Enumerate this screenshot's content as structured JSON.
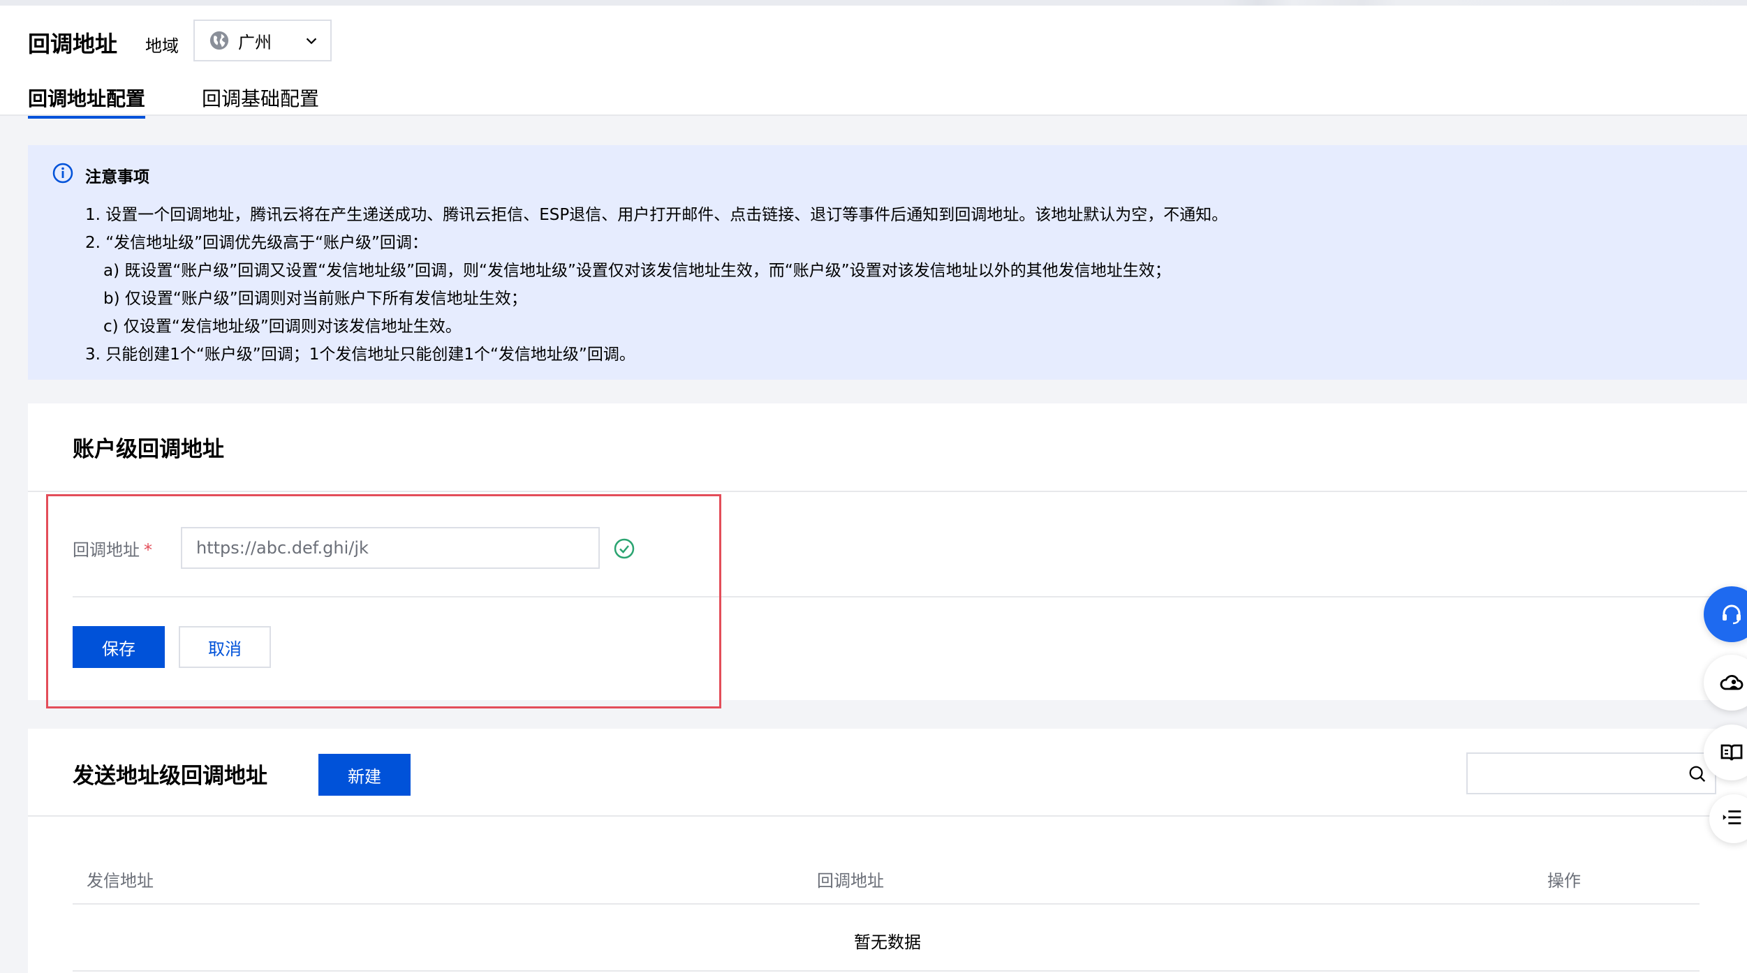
{
  "header": {
    "title": "回调地址",
    "region_label": "地域",
    "region_value": "广州",
    "tabs": [
      {
        "label": "回调地址配置",
        "active": true
      },
      {
        "label": "回调基础配置",
        "active": false
      }
    ]
  },
  "notice": {
    "title": "注意事项",
    "lines": [
      "1. 设置一个回调地址，腾讯云将在产生递送成功、腾讯云拒信、ESP退信、用户打开邮件、点击链接、退订等事件后通知到回调地址。该地址默认为空，不通知。",
      "2. “发信地址级”回调优先级高于“账户级”回调：",
      "a) 既设置“账户级”回调又设置“发信地址级”回调，则“发信地址级”设置仅对该发信地址生效，而“账户级”设置对该发信地址以外的其他发信地址生效；",
      "b) 仅设置“账户级”回调则对当前账户下所有发信地址生效；",
      "c) 仅设置“发信地址级”回调则对该发信地址生效。",
      "3. 只能创建1个“账户级”回调；1个发信地址只能创建1个“发信地址级”回调。"
    ]
  },
  "account_callback": {
    "title": "账户级回调地址",
    "field_label": "回调地址",
    "required_mark": "*",
    "url_value": "https://abc.def.ghi/jk",
    "save_label": "保存",
    "cancel_label": "取消"
  },
  "sender_callback": {
    "title": "发送地址级回调地址",
    "new_label": "新建",
    "search_placeholder": "",
    "columns": [
      "发信地址",
      "回调地址",
      "操作"
    ],
    "empty_text": "暂无数据"
  },
  "colors": {
    "primary": "#0052d9",
    "notice_bg": "#e6ecfe",
    "success": "#2ba471",
    "error_border": "#e34d59"
  },
  "icons": {
    "region": "globe-icon",
    "dropdown": "chevron-down-icon",
    "notice": "info-icon",
    "valid": "check-circle-icon",
    "search": "search-icon",
    "floating": [
      "headset-icon",
      "cloud-user-icon",
      "book-icon",
      "list-icon"
    ]
  }
}
